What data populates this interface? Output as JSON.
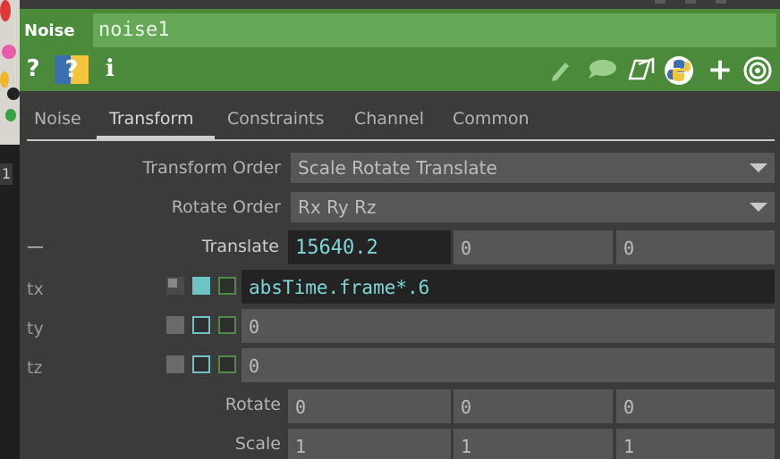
{
  "header": {
    "op_type": "Noise",
    "op_name": "noise1",
    "icons": [
      "help-icon",
      "python-help-icon",
      "info-icon",
      "edit-icon",
      "comment-icon",
      "clone-icon",
      "python-icon",
      "add-icon",
      "target-icon"
    ],
    "colors": {
      "header_bg": "#4a8a3a",
      "name_field_bg": "#67a858"
    }
  },
  "tabs": [
    "Noise",
    "Transform",
    "Constraints",
    "Channel",
    "Common"
  ],
  "active_tab": "Transform",
  "params": {
    "transform_order": {
      "label": "Transform Order",
      "value": "Scale Rotate Translate"
    },
    "rotate_order": {
      "label": "Rotate Order",
      "value": "Rx Ry Rz"
    },
    "translate": {
      "label": "Translate",
      "collapse_glyph": "—",
      "values": [
        "15640.2",
        "0",
        "0"
      ],
      "rows": [
        {
          "label": "tx",
          "value": "absTime.frame*.6",
          "mode": "expression"
        },
        {
          "label": "ty",
          "value": "0",
          "mode": "constant"
        },
        {
          "label": "tz",
          "value": "0",
          "mode": "constant"
        }
      ]
    },
    "rotate": {
      "label": "Rotate",
      "values": [
        "0",
        "0",
        "0"
      ]
    },
    "scale": {
      "label": "Scale",
      "values": [
        "1",
        "1",
        "1"
      ]
    }
  },
  "left_strip": {
    "marker": "1"
  },
  "colors": {
    "expression_text": "#7fd6d6",
    "panel_bg": "#3b3b3b",
    "field_bg": "#565656"
  }
}
